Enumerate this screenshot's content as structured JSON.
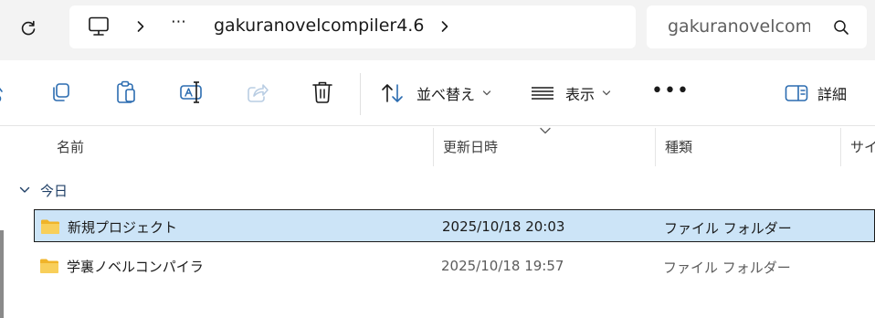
{
  "address_bar": {
    "refresh_icon": "refresh-icon",
    "root_icon": "this-pc-monitor-icon",
    "overflow_label": "⋯",
    "current_folder": "gakuranovelcompiler4.6"
  },
  "search": {
    "value": "gakuranovelcom",
    "icon": "search-icon"
  },
  "toolbar": {
    "sort_label": "並べ替え",
    "view_label": "表示",
    "more_label": "•••",
    "details_label": "詳細"
  },
  "columns": {
    "name": "名前",
    "modified": "更新日時",
    "type": "種類",
    "size": "サイ"
  },
  "groups": [
    {
      "label": "今日",
      "items": [
        {
          "name": "新規プロジェクト",
          "modified": "2025/10/18 20:03",
          "type": "ファイル フォルダー",
          "selected": true
        },
        {
          "name": "学裏ノベルコンパイラ",
          "modified": "2025/10/18 19:57",
          "type": "ファイル フォルダー",
          "selected": false
        }
      ]
    }
  ],
  "colors": {
    "selection_bg": "#cce4f7",
    "folder_yellow": "#f8c84a",
    "group_text": "#1f3f66"
  }
}
